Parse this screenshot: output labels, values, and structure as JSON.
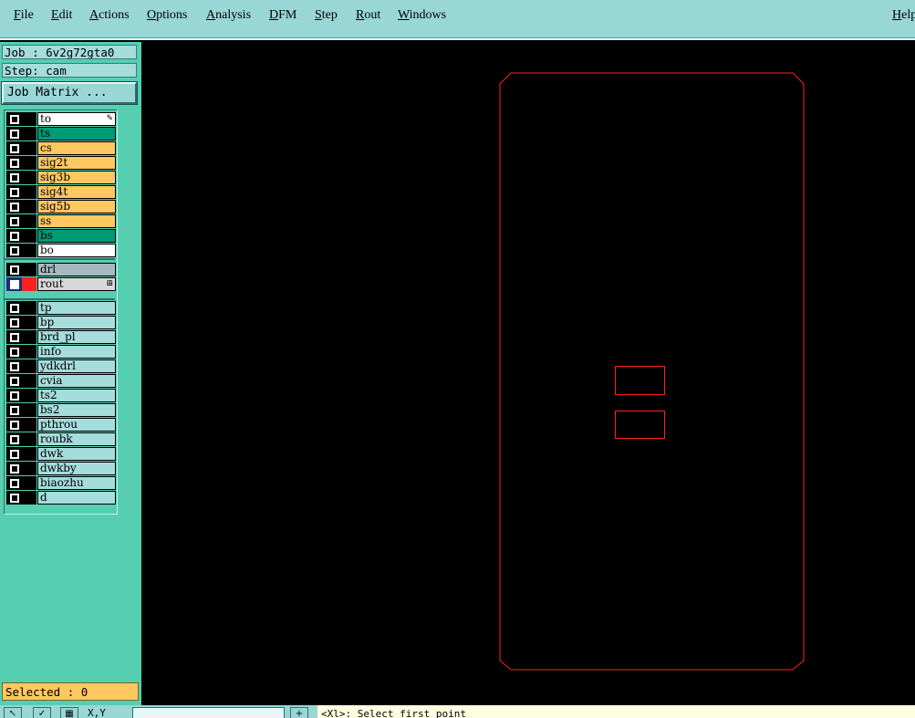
{
  "menu": {
    "items": [
      "File",
      "Edit",
      "Actions",
      "Options",
      "Analysis",
      "DFM",
      "Step",
      "Rout",
      "Windows"
    ],
    "help": "Help"
  },
  "panel": {
    "job": "Job : 6v2g72gta0",
    "step": "Step: cam",
    "job_matrix": "Job Matrix ...",
    "selected": "Selected : 0"
  },
  "layers": {
    "board": [
      {
        "name": "to",
        "color": "#ffffff"
      },
      {
        "name": "ts",
        "color": "#009a75"
      },
      {
        "name": "cs",
        "color": "#ffc860"
      },
      {
        "name": "sig2t",
        "color": "#ffc860"
      },
      {
        "name": "sig3b",
        "color": "#ffc860"
      },
      {
        "name": "sig4t",
        "color": "#ffc860"
      },
      {
        "name": "sig5b",
        "color": "#ffc860"
      },
      {
        "name": "ss",
        "color": "#ffc860"
      },
      {
        "name": "bs",
        "color": "#009a75"
      },
      {
        "name": "bo",
        "color": "#ffffff"
      }
    ],
    "drill": [
      {
        "name": "drl",
        "color": "#a8b8c0"
      },
      {
        "name": "rout",
        "color": "#d8d8d8",
        "active": true
      }
    ],
    "misc": [
      {
        "name": "tp"
      },
      {
        "name": "bp"
      },
      {
        "name": "brd_pl"
      },
      {
        "name": "info"
      },
      {
        "name": "ydkdrl"
      },
      {
        "name": "cvia"
      },
      {
        "name": "ts2"
      },
      {
        "name": "bs2"
      },
      {
        "name": "pthrou"
      },
      {
        "name": "roubk"
      },
      {
        "name": "dwk"
      },
      {
        "name": "dwkby"
      },
      {
        "name": "biaozhu"
      },
      {
        "name": "d"
      }
    ]
  },
  "status": {
    "xy_label": "X,Y",
    "prompt": "<Xl>: Select first point"
  },
  "colors": {
    "outline": "#ff2020",
    "canvas": "#000000",
    "panel": "#55cfb0"
  }
}
